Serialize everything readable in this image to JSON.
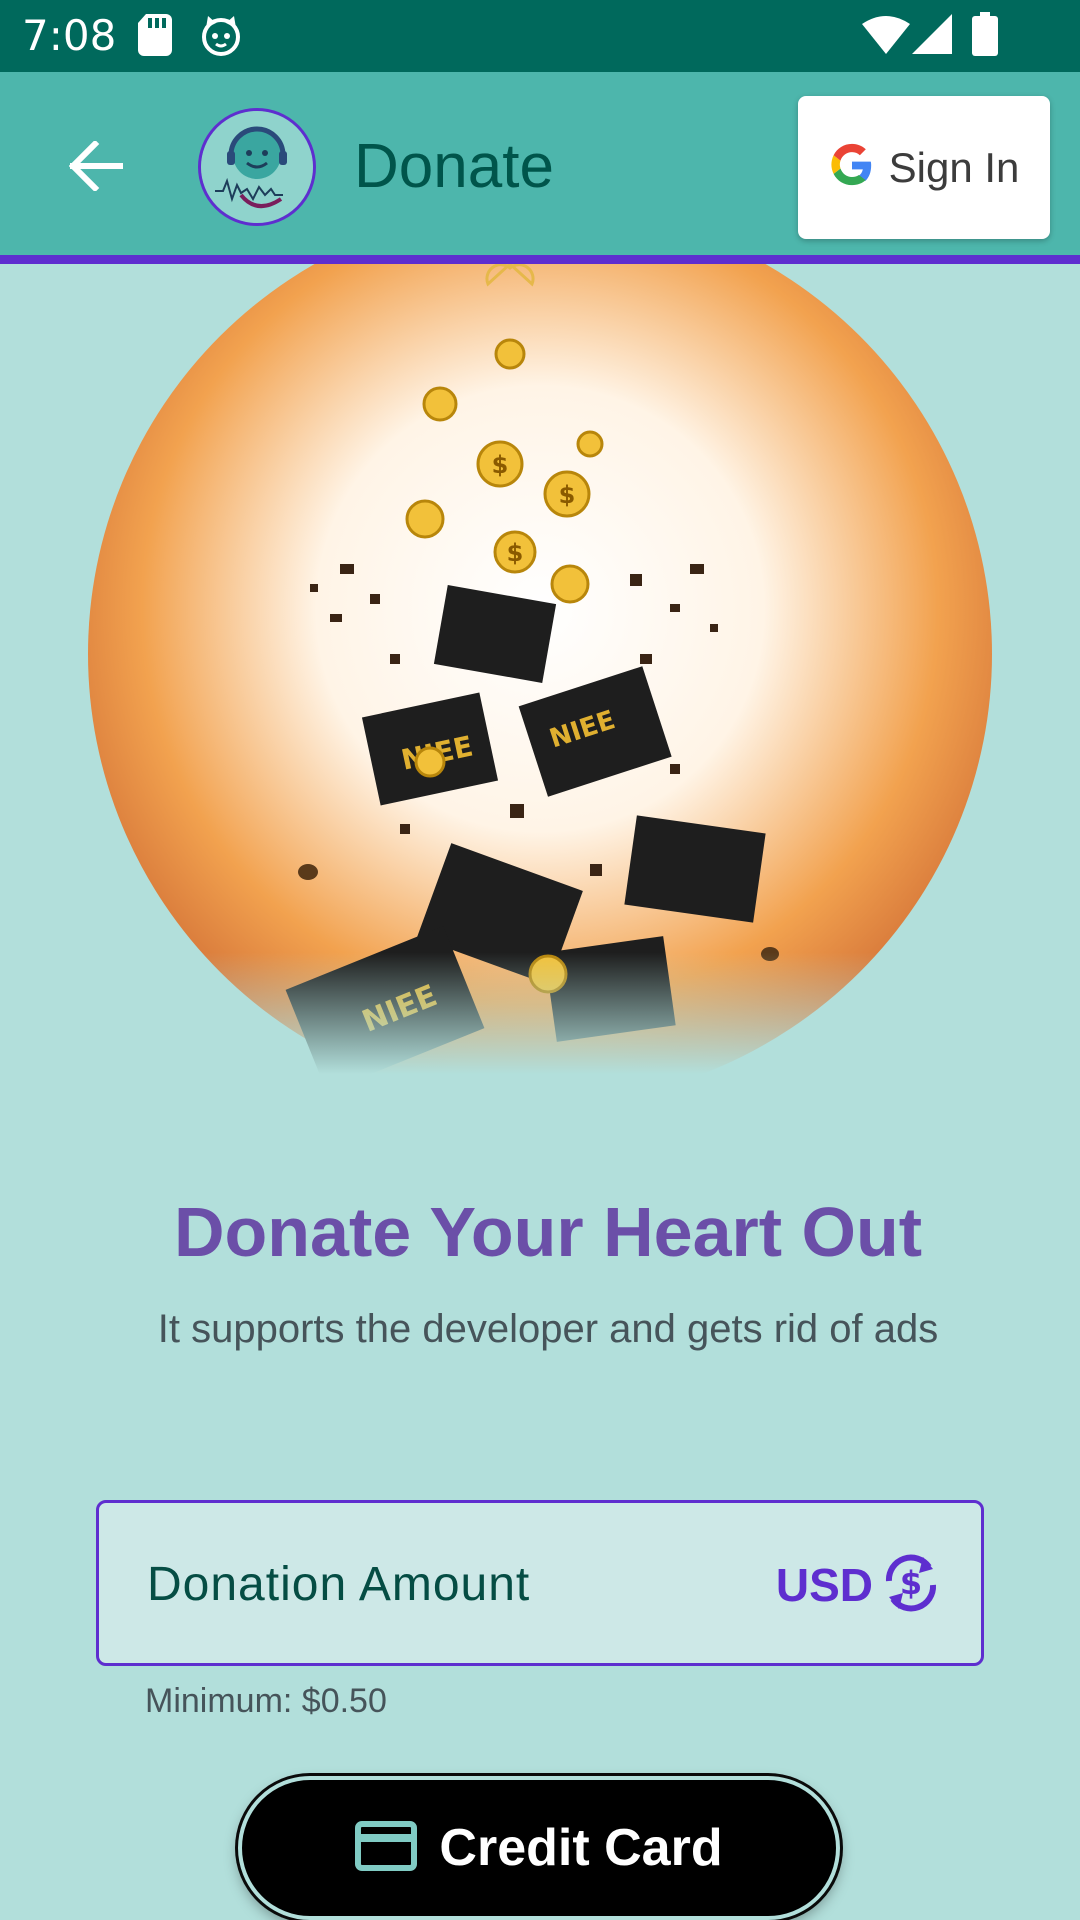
{
  "status_bar": {
    "time": "7:08",
    "left_icons": [
      "sd-card-icon",
      "cat-icon"
    ],
    "right_icons": [
      "wifi-icon",
      "signal-icon",
      "battery-icon"
    ]
  },
  "app_bar": {
    "title": "Donate",
    "back_icon": "arrow-left-icon",
    "logo_icon": "music-face-logo",
    "sign_in_label": "Sign In",
    "sign_in_icon": "google-g-icon"
  },
  "hero": {
    "image": "coins-and-cards-exploding-illustration"
  },
  "main": {
    "headline": "Donate Your Heart Out",
    "subline": "It supports the developer and gets rid of ads"
  },
  "donation_field": {
    "label": "Donation Amount",
    "currency": "USD",
    "currency_icon": "currency-exchange-icon",
    "hint": "Minimum: $0.50"
  },
  "payment": {
    "label": "Credit Card",
    "icon": "credit-card-icon"
  },
  "colors": {
    "status_bar": "#00695c",
    "app_bar": "#4db6ac",
    "background": "#b2dfdb",
    "accent": "#5e2ecf",
    "headline": "#6b4fa8"
  }
}
